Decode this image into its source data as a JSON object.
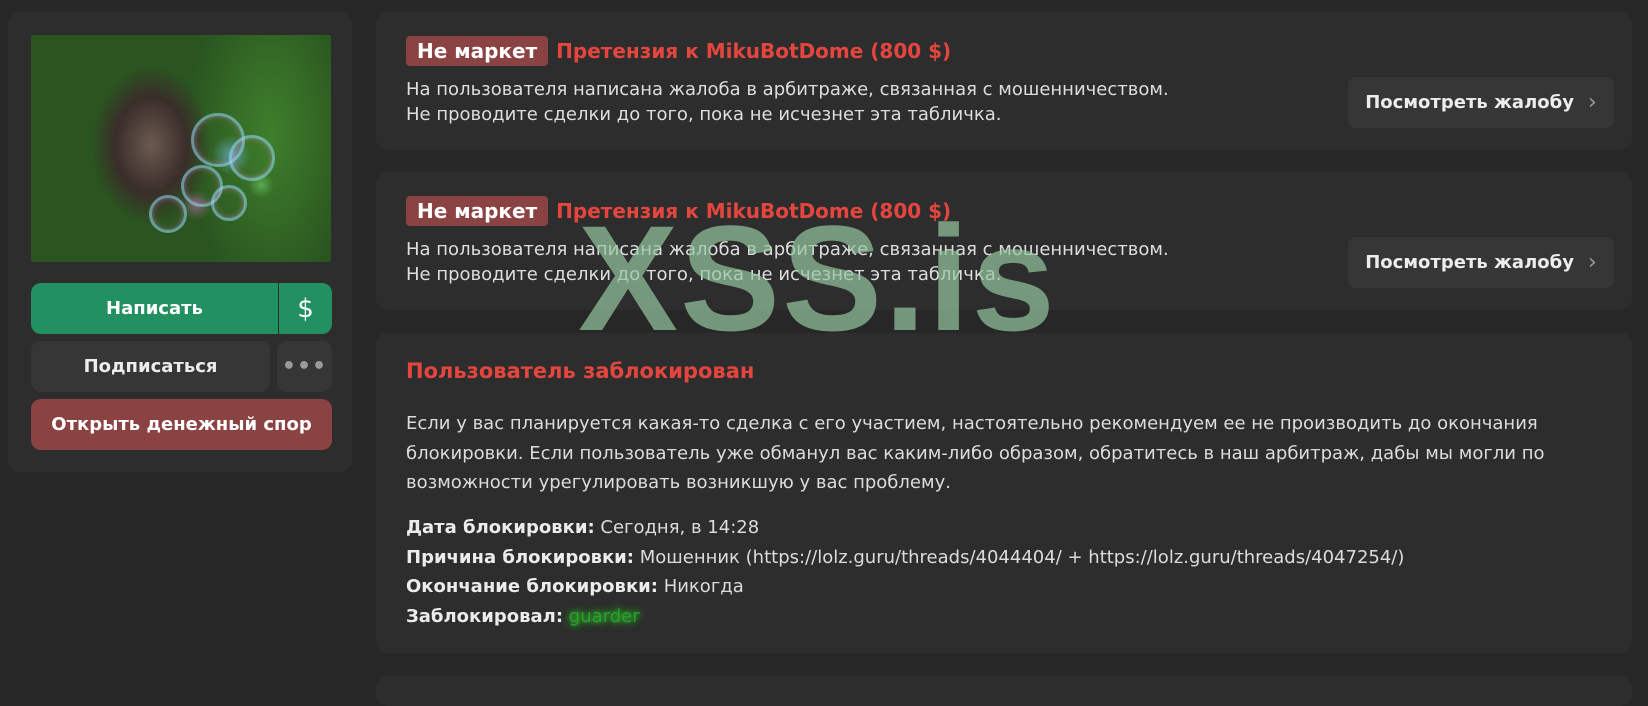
{
  "profile": {
    "avatar_alt": "",
    "write_label": "Написать",
    "dollar_icon": "$",
    "subscribe_label": "Подписаться",
    "more_icon": "•••",
    "dispute_label": "Открыть денежный спор"
  },
  "warnings": [
    {
      "badge": "Не маркет",
      "title": "Претензия к MikuBotDome (800 $)",
      "line1": "На пользователя написана жалоба в арбитраже, связанная с мошенничеством.",
      "line2": "Не проводите сделки до того, пока не исчезнет эта табличка.",
      "button": "Посмотреть жалобу"
    },
    {
      "badge": "Не маркет",
      "title": "Претензия к MikuBotDome (800 $)",
      "line1": "На пользователя написана жалоба в арбитраже, связанная с мошенничеством.",
      "line2": "Не проводите сделки до того, пока не исчезнет эта табличка.",
      "button": "Посмотреть жалобу"
    }
  ],
  "ban": {
    "title": "Пользователь заблокирован",
    "desc_line1": "Если у вас планируется какая-то сделка с его участием, настоятельно рекомендуем ее не производить до окончания",
    "desc_line2": "блокировки. Если пользователь уже обманул вас каким-либо образом, обратитесь в наш арбитраж, дабы мы могли по",
    "desc_line3": "возможности урегулировать возникшую у вас проблему.",
    "date_label": "Дата блокировки:",
    "date_value": "Сегодня, в 14:28",
    "reason_label": "Причина блокировки:",
    "reason_value": "Мошенник (https://lolz.guru/threads/4044404/ + https://lolz.guru/threads/4047254/)",
    "end_label": "Окончание блокировки:",
    "end_value": "Никогда",
    "by_label": "Заблокировал:",
    "by_value": "guarder"
  },
  "watermark": "XSS.is",
  "colors": {
    "accent_green": "#229061",
    "danger": "#e4463f",
    "badge_bg": "#8b4242"
  },
  "icons": {
    "chevron": "›"
  }
}
